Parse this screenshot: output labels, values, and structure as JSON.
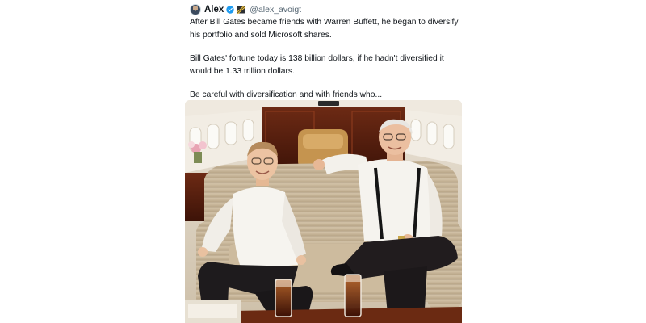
{
  "tweet": {
    "author_name": "Alex",
    "handle": "@alex_avoigt",
    "paragraphs": [
      "After Bill Gates became friends with Warren Buffett, he began to diversify his portfolio and sold Microsoft shares.",
      "Bill Gates' fortune today is 138 billion dollars, if he hadn't diversified it would be 1.33 trillion dollars.",
      "Be careful with diversification and with friends who..."
    ],
    "media": {
      "alt": "Bill Gates and Warren Buffett laughing on a private jet sofa"
    }
  },
  "colors": {
    "text": "#0f1419",
    "secondary_text": "#536471",
    "verified_blue": "#1d9bf0"
  },
  "icons": [
    "avatar",
    "verified-badge-icon",
    "flag-emoji-icon"
  ]
}
